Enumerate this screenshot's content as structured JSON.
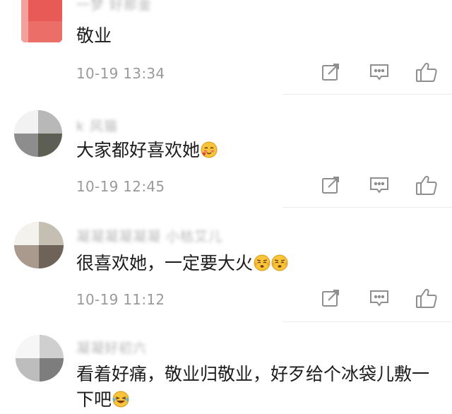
{
  "comments": [
    {
      "username": "一梦  好那金",
      "text": "敬业",
      "emoji": "",
      "time": "10-19 13:34"
    },
    {
      "username": "k        风猫",
      "text": "大家都好喜欢她",
      "emoji": "blush-face",
      "time": "10-19 12:45"
    },
    {
      "username": "凝凝凝凝凝凝  小枯艾儿",
      "text": "很喜欢她，一定要大火",
      "emoji": "pleading-face ×2",
      "time": "10-19 11:12"
    },
    {
      "username": "  凝凝好初六",
      "text": "看着好痛，敬业归敬业，好歹给个冰袋儿敷一下吧",
      "emoji": "crying-laughing-face",
      "time": ""
    }
  ],
  "actions": {
    "share_icon": "share-edit-icon",
    "reply_icon": "comment-bubble-icon",
    "like_icon": "thumbs-up-icon"
  },
  "colors": {
    "text": "#1c1c1c",
    "time": "#9a9a9a",
    "icon": "#9a9a9a",
    "avatar_red": "#e8544e"
  }
}
